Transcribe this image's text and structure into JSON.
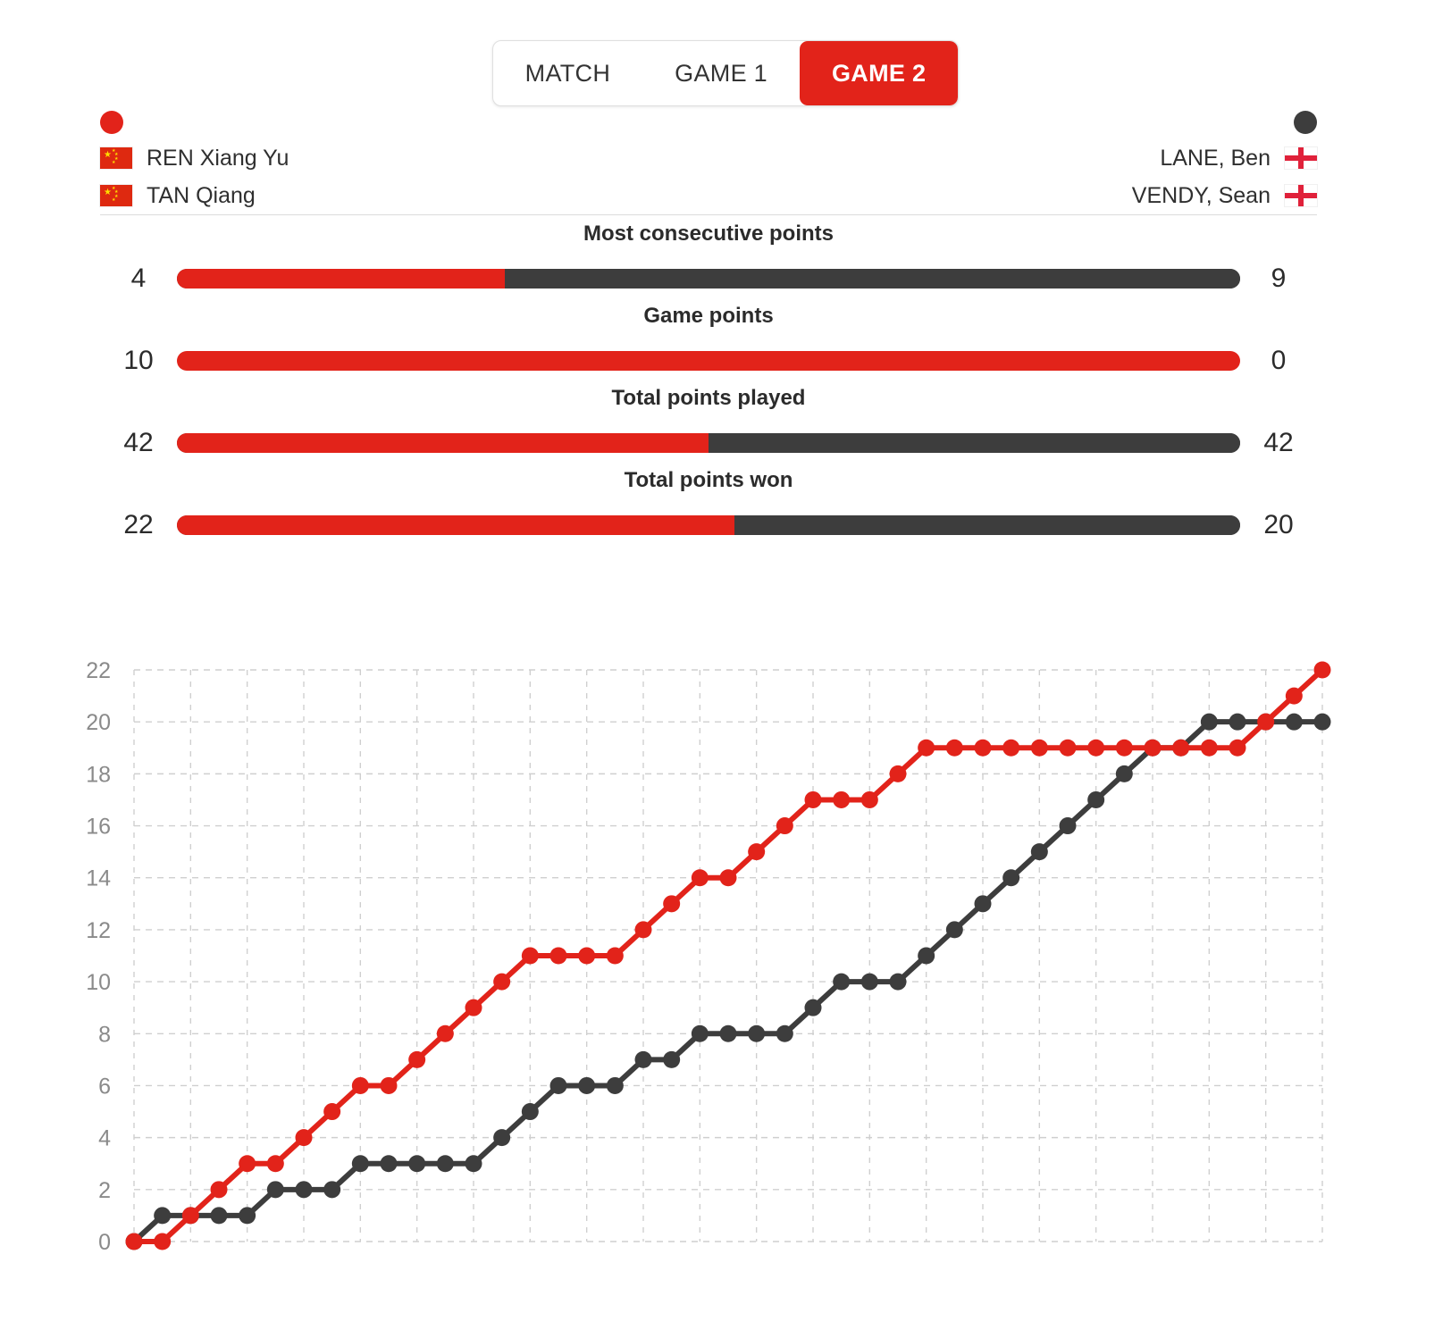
{
  "tabs": [
    {
      "label": "MATCH",
      "active": false
    },
    {
      "label": "GAME 1",
      "active": false
    },
    {
      "label": "GAME 2",
      "active": true
    }
  ],
  "colors": {
    "red": "#e2231a",
    "dark": "#3d3d3d",
    "grid": "#cfcfcf",
    "axis_text": "#8a8a8a"
  },
  "teams": {
    "left": {
      "marker": "red-dot",
      "players": [
        {
          "name": "REN Xiang Yu",
          "flag": "cn"
        },
        {
          "name": "TAN Qiang",
          "flag": "cn"
        }
      ]
    },
    "right": {
      "marker": "dark-dot",
      "players": [
        {
          "name": "LANE, Ben",
          "flag": "en"
        },
        {
          "name": "VENDY, Sean",
          "flag": "en"
        }
      ]
    }
  },
  "stats": [
    {
      "label": "Most consecutive points",
      "left": "4",
      "right": "9",
      "left_pct": 30.8
    },
    {
      "label": "Game points",
      "left": "10",
      "right": "0",
      "left_pct": 100
    },
    {
      "label": "Total points played",
      "left": "42",
      "right": "42",
      "left_pct": 50
    },
    {
      "label": "Total points won",
      "left": "22",
      "right": "20",
      "left_pct": 52.4
    }
  ],
  "chart_data": {
    "type": "line",
    "title": "",
    "xlabel": "",
    "ylabel": "",
    "ylim": [
      0,
      22
    ],
    "xlim": [
      0,
      42
    ],
    "yticks": [
      0,
      2,
      4,
      6,
      8,
      10,
      12,
      14,
      16,
      18,
      20,
      22
    ],
    "grid": true,
    "legend_position": "top",
    "x": [
      0,
      1,
      2,
      3,
      4,
      5,
      6,
      7,
      8,
      9,
      10,
      11,
      12,
      13,
      14,
      15,
      16,
      17,
      18,
      19,
      20,
      21,
      22,
      23,
      24,
      25,
      26,
      27,
      28,
      29,
      30,
      31,
      32,
      33,
      34,
      35,
      36,
      37,
      38,
      39,
      40,
      41,
      42
    ],
    "series": [
      {
        "name": "REN Xiang Yu / TAN Qiang",
        "color": "#e2231a",
        "values": [
          0,
          0,
          1,
          2,
          3,
          3,
          4,
          5,
          6,
          6,
          7,
          8,
          9,
          10,
          11,
          11,
          11,
          11,
          12,
          13,
          14,
          14,
          15,
          16,
          17,
          17,
          17,
          18,
          19,
          19,
          19,
          19,
          19,
          19,
          19,
          19,
          19,
          19,
          19,
          19,
          20,
          21,
          22
        ]
      },
      {
        "name": "LANE, Ben / VENDY, Sean",
        "color": "#3d3d3d",
        "values": [
          0,
          1,
          1,
          1,
          1,
          2,
          2,
          2,
          3,
          3,
          3,
          3,
          3,
          4,
          5,
          6,
          6,
          6,
          7,
          7,
          8,
          8,
          8,
          8,
          9,
          10,
          10,
          10,
          11,
          12,
          13,
          14,
          15,
          16,
          17,
          18,
          19,
          19,
          20,
          20,
          20,
          20,
          20
        ]
      }
    ]
  }
}
